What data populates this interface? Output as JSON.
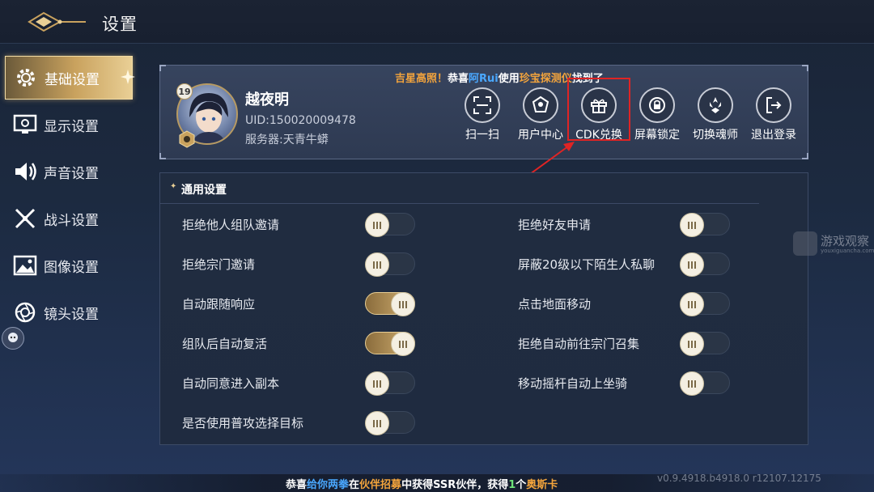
{
  "header": {
    "title": "设置"
  },
  "sidebar": {
    "items": [
      {
        "label": "基础设置",
        "icon": "gear-icon",
        "active": true
      },
      {
        "label": "显示设置",
        "icon": "monitor-icon",
        "active": false
      },
      {
        "label": "声音设置",
        "icon": "speaker-icon",
        "active": false
      },
      {
        "label": "战斗设置",
        "icon": "crossed-swords-icon",
        "active": false
      },
      {
        "label": "图像设置",
        "icon": "image-icon",
        "active": false
      },
      {
        "label": "镜头设置",
        "icon": "camera-lens-icon",
        "active": false
      }
    ]
  },
  "profile": {
    "ticker": {
      "part1": "吉星高照！",
      "part2": "恭喜",
      "player": "阿Rui",
      "part3": "使用",
      "item": "珍宝探测仪",
      "part4": "找到了"
    },
    "level": "19",
    "name": "越夜明",
    "uid": "UID:150020009478",
    "server": "服务器:天青牛蟒",
    "actions": [
      {
        "label": "扫一扫",
        "icon": "scan-icon"
      },
      {
        "label": "用户中心",
        "icon": "user-center-icon"
      },
      {
        "label": "CDK兑换",
        "icon": "gift-icon"
      },
      {
        "label": "屏幕锁定",
        "icon": "lock-icon"
      },
      {
        "label": "切换魂师",
        "icon": "switch-character-icon"
      },
      {
        "label": "退出登录",
        "icon": "logout-icon"
      }
    ]
  },
  "general": {
    "title": "通用设置",
    "left": [
      {
        "label": "拒绝他人组队邀请",
        "on": false
      },
      {
        "label": "拒绝宗门邀请",
        "on": false
      },
      {
        "label": "自动跟随响应",
        "on": true
      },
      {
        "label": "组队后自动复活",
        "on": true
      },
      {
        "label": "自动同意进入副本",
        "on": false
      },
      {
        "label": "是否使用普攻选择目标",
        "on": false
      }
    ],
    "right": [
      {
        "label": "拒绝好友申请",
        "on": false
      },
      {
        "label": "屏蔽20级以下陌生人私聊",
        "on": false
      },
      {
        "label": "点击地面移动",
        "on": false
      },
      {
        "label": "拒绝自动前往宗门召集",
        "on": false
      },
      {
        "label": "移动摇杆自动上坐骑",
        "on": false
      }
    ]
  },
  "watermark": {
    "text": "游戏观察",
    "sub": "youxiguancha.com"
  },
  "footer": {
    "part1": "恭喜",
    "player": "给你两拳",
    "part2": "在",
    "event": "伙伴招募",
    "part3": "中获得SSR伙伴，获得",
    "count": "1",
    "part4": "个",
    "reward": "奥斯卡"
  },
  "version": "v0.9.4918.b4918.0 r12107.12175",
  "colors": {
    "accent_gold": "#d2b072",
    "highlight_red": "#e02424",
    "ticker_gold": "#f3a43c",
    "link_blue": "#4aa8ff"
  }
}
